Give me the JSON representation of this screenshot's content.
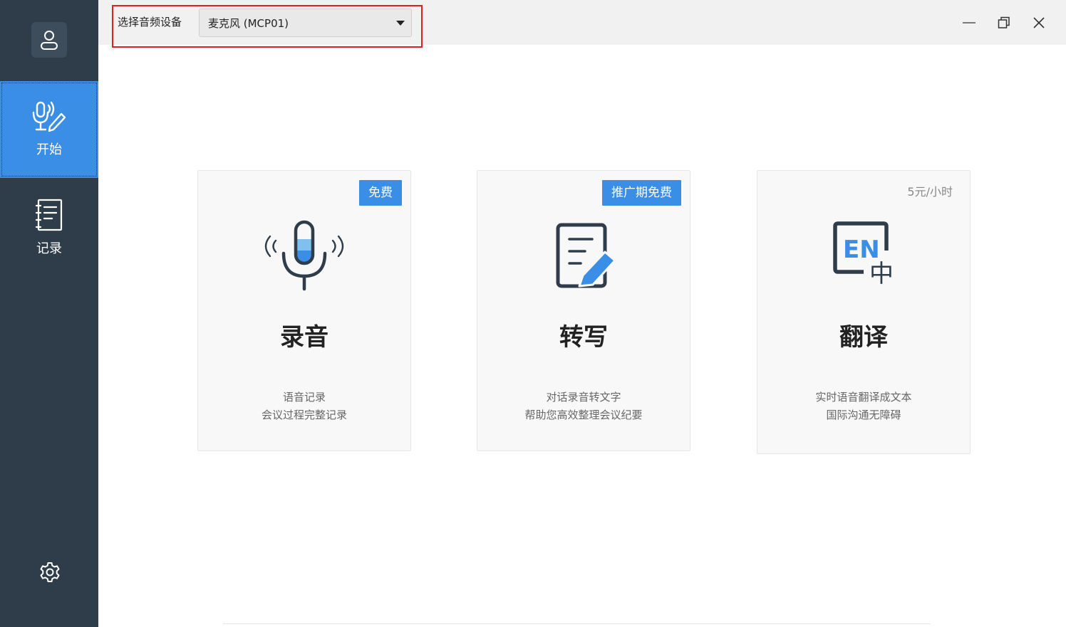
{
  "sidebar": {
    "items": [
      {
        "label": "开始",
        "icon": "mic-pen-icon",
        "active": true
      },
      {
        "label": "记录",
        "icon": "notebook-icon",
        "active": false
      }
    ],
    "avatar_icon": "user-icon",
    "settings_icon": "gear-icon"
  },
  "titlebar": {
    "device_label": "选择音频设备",
    "device_value": "麦克风 (MCP01)",
    "window_controls": [
      "minimize-icon",
      "restore-icon",
      "close-icon"
    ]
  },
  "cards": {
    "record": {
      "badge": "免费",
      "title": "录音",
      "desc1": "语音记录",
      "desc2": "会议过程完整记录",
      "icon": "microphone-icon"
    },
    "transcribe": {
      "badge": "推广期免费",
      "title": "转写",
      "desc1": "对话录音转文字",
      "desc2": "帮助您高效整理会议纪要",
      "icon": "document-pen-icon"
    },
    "translate": {
      "price": "5元/小时",
      "title": "翻译",
      "desc1": "实时语音翻译成文本",
      "desc2": "国际沟通无障碍",
      "icon": "en-zh-translate-icon",
      "icon_text_en": "EN",
      "icon_text_zh": "中"
    }
  },
  "colors": {
    "sidebar_bg": "#2f3d4a",
    "accent": "#3a8ee6",
    "card_bg": "#f8f8f8",
    "highlight_border": "#e02020"
  }
}
